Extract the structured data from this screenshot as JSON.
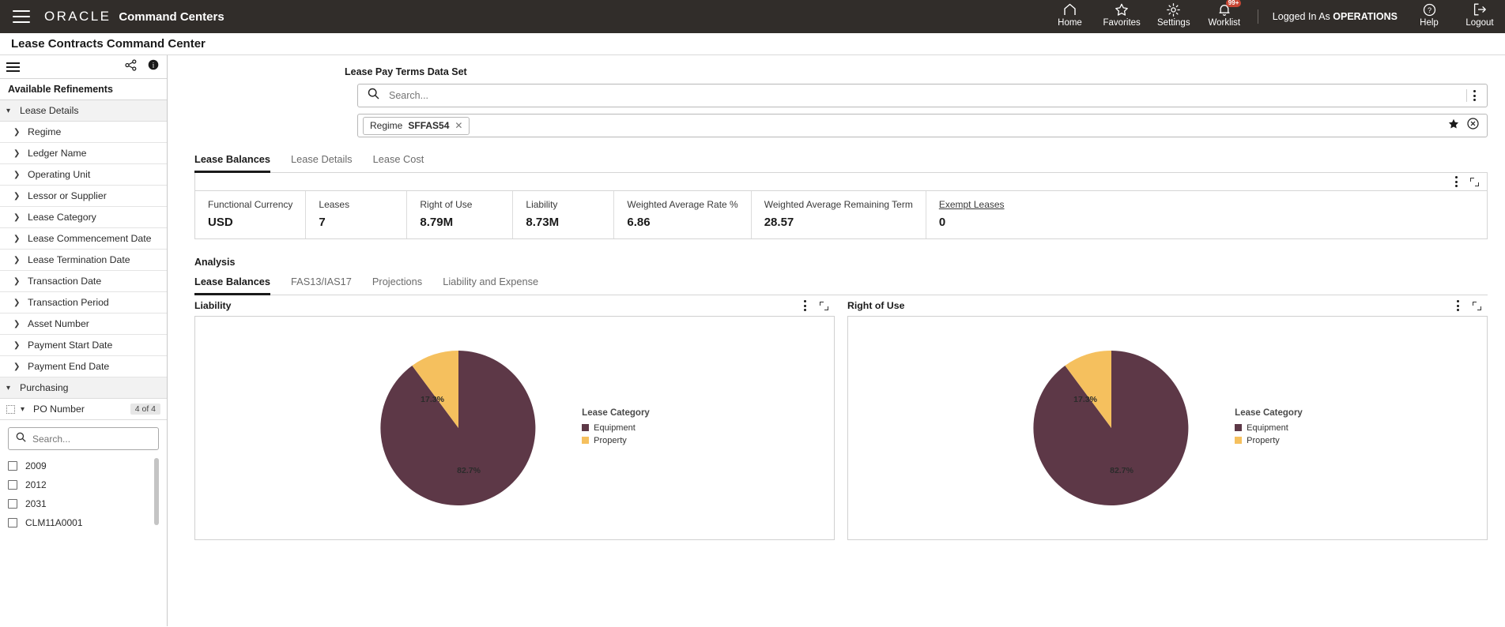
{
  "topbar": {
    "menu_icon": "hamburger-icon",
    "brand": "ORACLE",
    "app_name": "Command Centers",
    "nav": [
      {
        "label": "Home",
        "icon": "home-icon"
      },
      {
        "label": "Favorites",
        "icon": "star-icon"
      },
      {
        "label": "Settings",
        "icon": "gear-icon"
      },
      {
        "label": "Worklist",
        "icon": "bell-icon",
        "badge": "99+"
      }
    ],
    "logged_in_prefix": "Logged In As",
    "logged_in_user": "OPERATIONS",
    "help_label": "Help",
    "help_icon": "question-circle-icon",
    "logout_label": "Logout",
    "logout_icon": "logout-arrow-icon"
  },
  "page": {
    "title": "Lease Contracts Command Center"
  },
  "sidebar": {
    "menu_icon": "hamburger-icon",
    "share_icon": "share-icon",
    "info_icon": "info-icon",
    "header": "Available Refinements",
    "groups": [
      {
        "label": "Lease Details",
        "expanded": true,
        "items": [
          "Regime",
          "Ledger Name",
          "Operating Unit",
          "Lessor or Supplier",
          "Lease Category",
          "Lease Commencement Date",
          "Lease Termination Date",
          "Transaction Date",
          "Transaction Period",
          "Asset Number",
          "Payment Start Date",
          "Payment End Date"
        ]
      },
      {
        "label": "Purchasing",
        "expanded": true,
        "items": []
      }
    ],
    "po_number": {
      "label": "PO Number",
      "count": "4 of 4",
      "search_placeholder": "Search...",
      "search_value": "",
      "search_icon": "search-icon",
      "options": [
        {
          "label": "2009",
          "checked": false
        },
        {
          "label": "2012",
          "checked": false
        },
        {
          "label": "2031",
          "checked": false
        },
        {
          "label": "CLM11A0001",
          "checked": false
        }
      ]
    }
  },
  "dataset": {
    "label": "Lease Pay Terms Data Set",
    "search_placeholder": "Search...",
    "search_value": "",
    "search_icon": "search-icon",
    "kebab_icon": "more-vertical-icon"
  },
  "filters": {
    "chips": [
      {
        "name": "Regime",
        "value": "SFFAS54",
        "remove_icon": "close-icon"
      }
    ],
    "star_icon": "star-filled-icon",
    "clear_icon": "clear-circle-icon"
  },
  "main_tabs": [
    {
      "label": "Lease Balances",
      "active": true
    },
    {
      "label": "Lease Details",
      "active": false
    },
    {
      "label": "Lease Cost",
      "active": false
    }
  ],
  "metrics_panel": {
    "kebab_icon": "more-vertical-icon",
    "expand_icon": "expand-icon",
    "metrics": [
      {
        "label": "Functional Currency",
        "value": "USD",
        "underlined": false
      },
      {
        "label": "Leases",
        "value": "7",
        "underlined": false
      },
      {
        "label": "Right of Use",
        "value": "8.79M",
        "underlined": false
      },
      {
        "label": "Liability",
        "value": "8.73M",
        "underlined": false
      },
      {
        "label": "Weighted Average Rate %",
        "value": "6.86",
        "underlined": false
      },
      {
        "label": "Weighted Average Remaining Term",
        "value": "28.57",
        "underlined": false
      },
      {
        "label": "Exempt Leases",
        "value": "0",
        "underlined": true
      }
    ]
  },
  "analysis": {
    "title": "Analysis",
    "tabs": [
      {
        "label": "Lease Balances",
        "active": true
      },
      {
        "label": "FAS13/IAS17",
        "active": false
      },
      {
        "label": "Projections",
        "active": false
      },
      {
        "label": "Liability and Expense",
        "active": false
      }
    ]
  },
  "colors": {
    "equipment": "#5d3847",
    "property": "#f5c05e",
    "header_bg": "#312d2a",
    "accent_red": "#c74634"
  },
  "chart_data": [
    {
      "type": "pie",
      "title": "Liability",
      "legend_title": "Lease Category",
      "legend_position": "right",
      "categories": [
        "Equipment",
        "Property"
      ],
      "values": [
        82.7,
        17.3
      ],
      "labels": [
        "82.7%",
        "17.3%"
      ],
      "colors": [
        "#5d3847",
        "#f5c05e"
      ],
      "kebab_icon": "more-vertical-icon",
      "expand_icon": "expand-icon"
    },
    {
      "type": "pie",
      "title": "Right of Use",
      "legend_title": "Lease Category",
      "legend_position": "right",
      "categories": [
        "Equipment",
        "Property"
      ],
      "values": [
        82.7,
        17.3
      ],
      "labels": [
        "82.7%",
        "17.3%"
      ],
      "colors": [
        "#5d3847",
        "#f5c05e"
      ],
      "kebab_icon": "more-vertical-icon",
      "expand_icon": "expand-icon"
    }
  ]
}
